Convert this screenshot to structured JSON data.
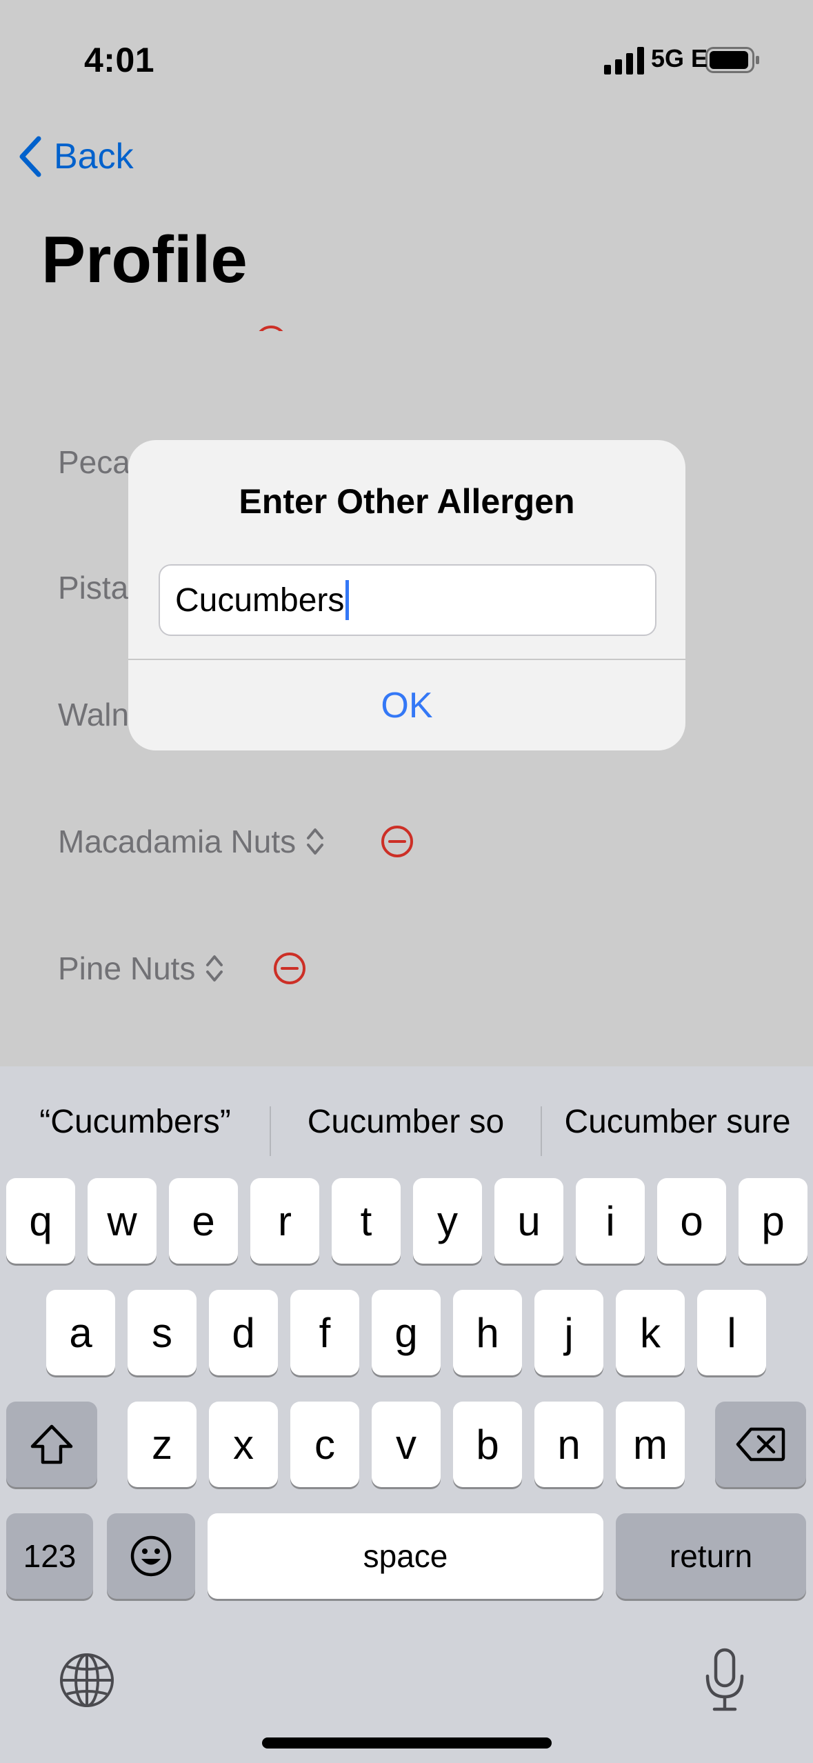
{
  "status_bar": {
    "time": "4:01",
    "network": "5G E",
    "signal_icon": "cellular-signal-icon",
    "battery_icon": "battery-icon"
  },
  "nav": {
    "back_label": "Back",
    "back_icon": "chevron-left-icon"
  },
  "page": {
    "title": "Profile"
  },
  "allergens": [
    {
      "label": "Peca"
    },
    {
      "label": "Pista"
    },
    {
      "label": "Waln"
    },
    {
      "label": "Macadamia Nuts"
    },
    {
      "label": "Pine Nuts"
    }
  ],
  "alert": {
    "title": "Enter Other Allergen",
    "input_value": "Cucumbers",
    "ok_label": "OK"
  },
  "keyboard": {
    "suggestions": [
      "“Cucumbers”",
      "Cucumber so",
      "Cucumber sure"
    ],
    "row1": [
      "q",
      "w",
      "e",
      "r",
      "t",
      "y",
      "u",
      "i",
      "o",
      "p"
    ],
    "row2": [
      "a",
      "s",
      "d",
      "f",
      "g",
      "h",
      "j",
      "k",
      "l"
    ],
    "row3": [
      "z",
      "x",
      "c",
      "v",
      "b",
      "n",
      "m"
    ],
    "numbers_label": "123",
    "space_label": "space",
    "return_label": "return",
    "icons": [
      "shift-icon",
      "backspace-icon",
      "emoji-icon",
      "globe-icon",
      "microphone-icon"
    ]
  },
  "colors": {
    "accent": "#3478f6",
    "destructive": "#ff3b30",
    "keyboard_bg": "#d1d3d9"
  }
}
